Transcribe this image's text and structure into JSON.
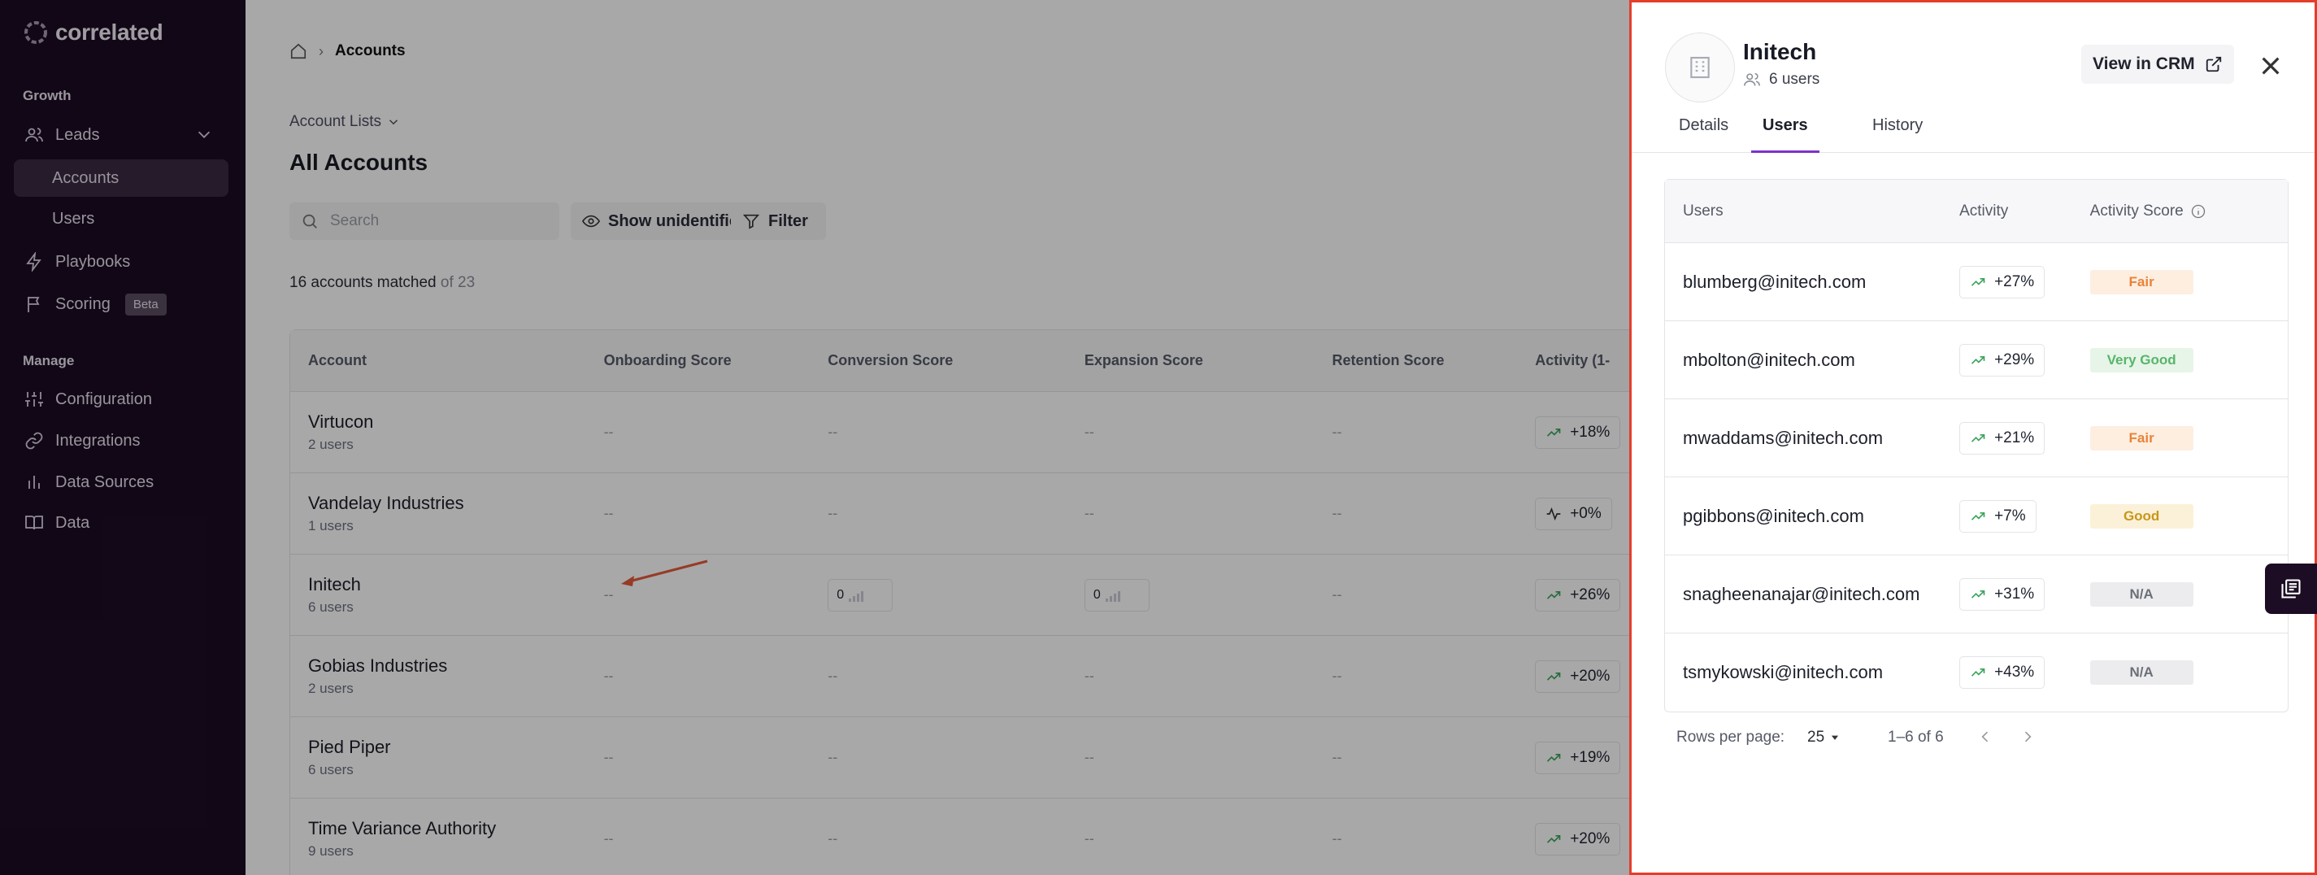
{
  "app": {
    "name": "correlated"
  },
  "sidebar": {
    "sections": {
      "growth": "Growth",
      "manage": "Manage"
    },
    "leads": "Leads",
    "accounts": "Accounts",
    "users": "Users",
    "playbooks": "Playbooks",
    "scoring": "Scoring",
    "scoring_badge": "Beta",
    "configuration": "Configuration",
    "integrations": "Integrations",
    "data_sources": "Data Sources",
    "data": "Data"
  },
  "main": {
    "breadcrumb_current": "Accounts",
    "account_lists": "Account Lists",
    "title": "All Accounts",
    "search_placeholder": "Search",
    "show_unidentified": "Show unidentified account",
    "filter": "Filter",
    "matched_count": "16 accounts matched",
    "matched_total": "of 23",
    "columns": [
      "Account",
      "Onboarding Score",
      "Conversion Score",
      "Expansion Score",
      "Retention Score",
      "Activity (1-"
    ],
    "rows": [
      {
        "name": "Virtucon",
        "users": "2 users",
        "onboarding": "--",
        "conversion": "--",
        "expansion": "--",
        "retention": "--",
        "activity": "+18%",
        "trend": "up"
      },
      {
        "name": "Vandelay Industries",
        "users": "1 users",
        "onboarding": "--",
        "conversion": "--",
        "expansion": "--",
        "retention": "--",
        "activity": "+0%",
        "trend": "flat"
      },
      {
        "name": "Initech",
        "users": "6 users",
        "onboarding": "--",
        "conversion": "0",
        "expansion": "0",
        "retention": "--",
        "activity": "+26%",
        "trend": "up"
      },
      {
        "name": "Gobias Industries",
        "users": "2 users",
        "onboarding": "--",
        "conversion": "--",
        "expansion": "--",
        "retention": "--",
        "activity": "+20%",
        "trend": "up"
      },
      {
        "name": "Pied Piper",
        "users": "6 users",
        "onboarding": "--",
        "conversion": "--",
        "expansion": "--",
        "retention": "--",
        "activity": "+19%",
        "trend": "up"
      },
      {
        "name": "Time Variance Authority",
        "users": "9 users",
        "onboarding": "--",
        "conversion": "--",
        "expansion": "--",
        "retention": "--",
        "activity": "+20%",
        "trend": "up"
      }
    ]
  },
  "drawer": {
    "title": "Initech",
    "subtitle": "6 users",
    "view_crm": "View in CRM",
    "tabs": [
      "Details",
      "Users",
      "History"
    ],
    "active_tab": "Users",
    "columns": [
      "Users",
      "Activity",
      "Activity Score"
    ],
    "users": [
      {
        "email": "blumberg@initech.com",
        "activity": "+27%",
        "score": "Fair",
        "score_color": "#e8833a",
        "score_bg": "#fdeee0"
      },
      {
        "email": "mbolton@initech.com",
        "activity": "+29%",
        "score": "Very Good",
        "score_color": "#58b56a",
        "score_bg": "#e6f5e8"
      },
      {
        "email": "mwaddams@initech.com",
        "activity": "+21%",
        "score": "Fair",
        "score_color": "#e8833a",
        "score_bg": "#fdeee0"
      },
      {
        "email": "pgibbons@initech.com",
        "activity": "+7%",
        "score": "Good",
        "score_color": "#c9961a",
        "score_bg": "#fbf1d8"
      },
      {
        "email": "snagheenanajar@initech.com",
        "activity": "+31%",
        "score": "N/A",
        "score_color": "#6b6f78",
        "score_bg": "#ececee"
      },
      {
        "email": "tsmykowski@initech.com",
        "activity": "+43%",
        "score": "N/A",
        "score_color": "#6b6f78",
        "score_bg": "#ececee"
      }
    ],
    "rows_per_page_label": "Rows per page:",
    "rows_per_page": "25",
    "range": "1–6 of 6"
  },
  "colors": {
    "sidebar_bg": "#1c0c24",
    "accent": "#7c33c9",
    "highlight_border": "#e43e2b",
    "trend_up": "#3aa45c"
  }
}
